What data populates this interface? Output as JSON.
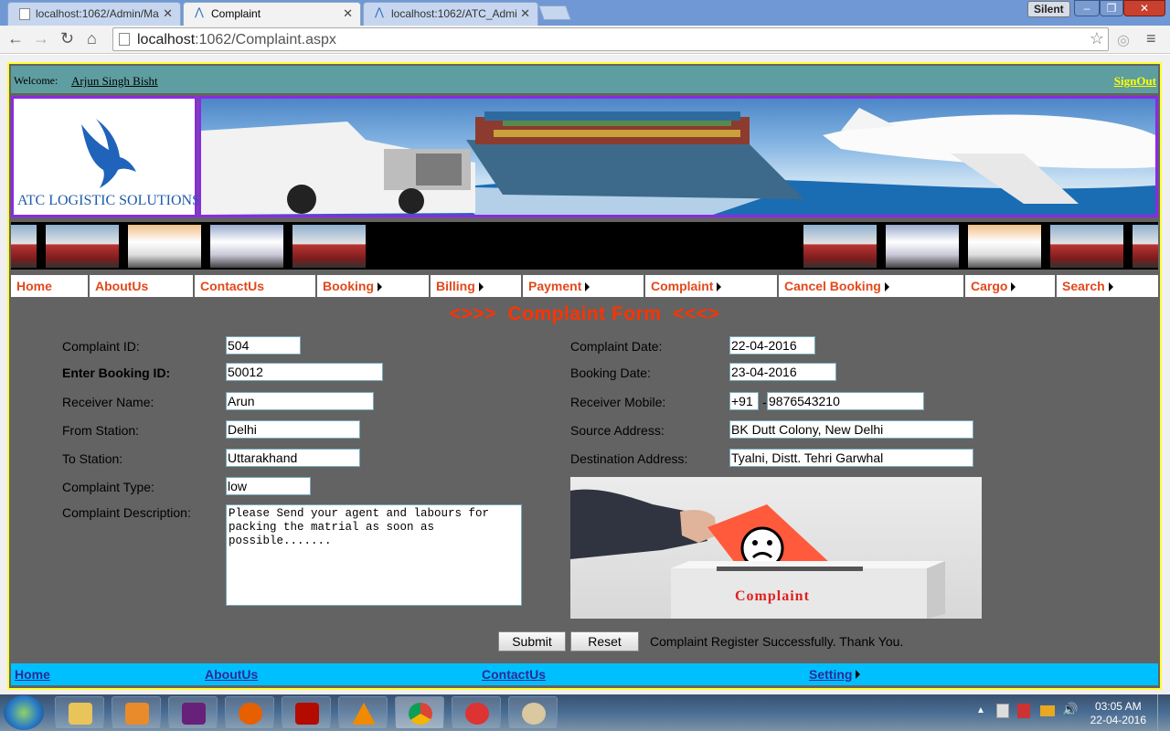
{
  "browser": {
    "tabs": [
      {
        "title": "localhost:1062/Admin/Ma",
        "active": false
      },
      {
        "title": "Complaint",
        "active": true
      },
      {
        "title": "localhost:1062/ATC_Admi",
        "active": false
      }
    ],
    "profile_badge": "Silent",
    "url_host": "localhost",
    "url_path": ":1062/Complaint.aspx"
  },
  "header": {
    "welcome_label": "Welcome:",
    "user_name": "Arjun Singh Bisht",
    "signout_label": "SignOut"
  },
  "logo_text": "ATC LOGISTIC SOLUTIONS LTD.",
  "menu": [
    {
      "label": "Home",
      "has_submenu": false
    },
    {
      "label": "AboutUs",
      "has_submenu": false
    },
    {
      "label": "ContactUs",
      "has_submenu": false
    },
    {
      "label": "Booking",
      "has_submenu": true
    },
    {
      "label": "Billing",
      "has_submenu": true
    },
    {
      "label": "Payment",
      "has_submenu": true
    },
    {
      "label": "Complaint",
      "has_submenu": true
    },
    {
      "label": "Cancel Booking",
      "has_submenu": true
    },
    {
      "label": "Cargo",
      "has_submenu": true
    },
    {
      "label": "Search",
      "has_submenu": true
    }
  ],
  "form": {
    "title": "<>>>  Complaint Form  <<<>",
    "complaint_id_label": "Complaint ID:",
    "complaint_id": "504",
    "booking_id_label": "Enter Booking ID:",
    "booking_id": "50012",
    "receiver_name_label": "Receiver Name:",
    "receiver_name": "Arun",
    "from_station_label": "From Station:",
    "from_station": "Delhi",
    "to_station_label": "To Station:",
    "to_station": "Uttarakhand",
    "complaint_type_label": "Complaint Type:",
    "complaint_type": "low",
    "description_label": "Complaint Description:",
    "description": "Please Send your agent and labours for\npacking the matrial as soon as\npossible.......",
    "complaint_date_label": "Complaint Date:",
    "complaint_date": "22-04-2016",
    "booking_date_label": "Booking Date:",
    "booking_date": "23-04-2016",
    "receiver_mobile_label": "Receiver Mobile:",
    "mobile_code": "+91",
    "mobile_separator": "-",
    "mobile_number": "9876543210",
    "source_address_label": "Source Address:",
    "source_address": "BK Dutt Colony, New Delhi",
    "destination_address_label": "Destination Address:",
    "destination_address": "Tyalni, Distt. Tehri Garwhal",
    "image_caption": "Complaint",
    "submit_label": "Submit",
    "reset_label": "Reset",
    "status_message": "Complaint Register Successfully. Thank You."
  },
  "footer": {
    "home": "Home",
    "about": "AboutUs",
    "contact": "ContactUs",
    "setting": "Setting"
  },
  "taskbar": {
    "time": "03:05 AM",
    "date": "22-04-2016"
  },
  "colors": {
    "menu_text": "#e2491b",
    "title": "#ff3300",
    "header_bar": "#5f9ea0",
    "footer_bar": "#00bfff",
    "frame_border": "#ffff33",
    "banner_border": "#8a2be2"
  }
}
